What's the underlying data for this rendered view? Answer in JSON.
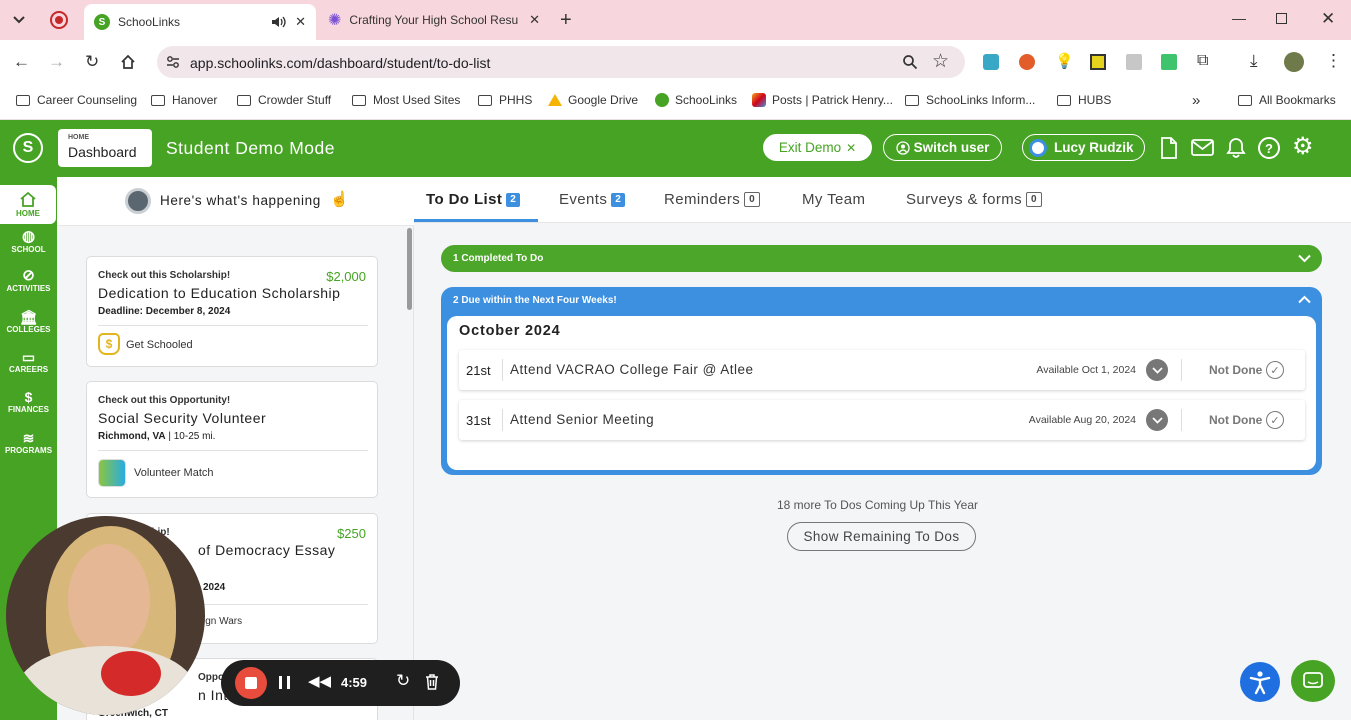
{
  "browser": {
    "tabs": [
      {
        "title": "SchooLinks",
        "active": true
      },
      {
        "title": "Crafting Your High School Resu",
        "active": false
      }
    ],
    "url": "app.schoolinks.com/dashboard/student/to-do-list",
    "bookmarks": [
      "Career Counseling",
      "Hanover",
      "Crowder Stuff",
      "Most Used Sites",
      "PHHS",
      "Google Drive",
      "SchooLinks",
      "Posts | Patrick Henry...",
      "SchooLinks Inform...",
      "HUBS"
    ],
    "all_bookmarks": "All Bookmarks"
  },
  "header": {
    "dash_small": "HOME",
    "dash_label": "Dashboard",
    "mode_title": "Student Demo Mode",
    "exit_demo": "Exit Demo",
    "switch_user": "Switch user",
    "user_name": "Lucy Rudzik",
    "colors": {
      "brand": "#47a324",
      "accent": "#3d8fe0"
    }
  },
  "leftnav": [
    "HOME",
    "SCHOOL",
    "ACTIVITIES",
    "COLLEGES",
    "CAREERS",
    "FINANCES",
    "PROGRAMS"
  ],
  "feed": {
    "heading": "Here's what's happening",
    "cards": [
      {
        "tag": "Check out this Scholarship!",
        "title": "Dedication to Education Scholarship",
        "meta": "Deadline: December 8, 2024",
        "amount": "$2,000",
        "source": "Get Schooled"
      },
      {
        "tag": "Check out this Opportunity!",
        "title": "Social Security Volunteer",
        "meta_bold": "Richmond, VA",
        "meta_rest": " | 10-25 mi.",
        "source": "Volunteer Match"
      },
      {
        "tag": "is Scholarship!",
        "title": "of Democracy Essay",
        "meta": "2024",
        "amount": "$250",
        "source": "ign Wars"
      },
      {
        "tag": "Opportunit",
        "title": "n Intern",
        "meta": "Greenwich, CT"
      }
    ]
  },
  "main": {
    "tabs": [
      {
        "label": "To Do List",
        "badge": "2",
        "active": true
      },
      {
        "label": "Events",
        "badge": "2"
      },
      {
        "label": "Reminders",
        "badge": "0"
      },
      {
        "label": "My Team",
        "badge": ""
      },
      {
        "label": "Surveys & forms",
        "badge": "0"
      }
    ],
    "completed_label": "1 Completed To Do",
    "due_label": "2 Due within the Next Four Weeks!",
    "month": "October 2024",
    "todos": [
      {
        "day": "21st",
        "title": "Attend VACRAO College Fair @ Atlee",
        "available": "Available Oct 1, 2024",
        "status": "Not Done"
      },
      {
        "day": "31st",
        "title": "Attend Senior Meeting",
        "available": "Available Aug 20, 2024",
        "status": "Not Done"
      }
    ],
    "more_text": "18 more To Dos Coming Up This Year",
    "show_remaining": "Show Remaining To Dos"
  },
  "recorder": {
    "time": "4:59"
  }
}
